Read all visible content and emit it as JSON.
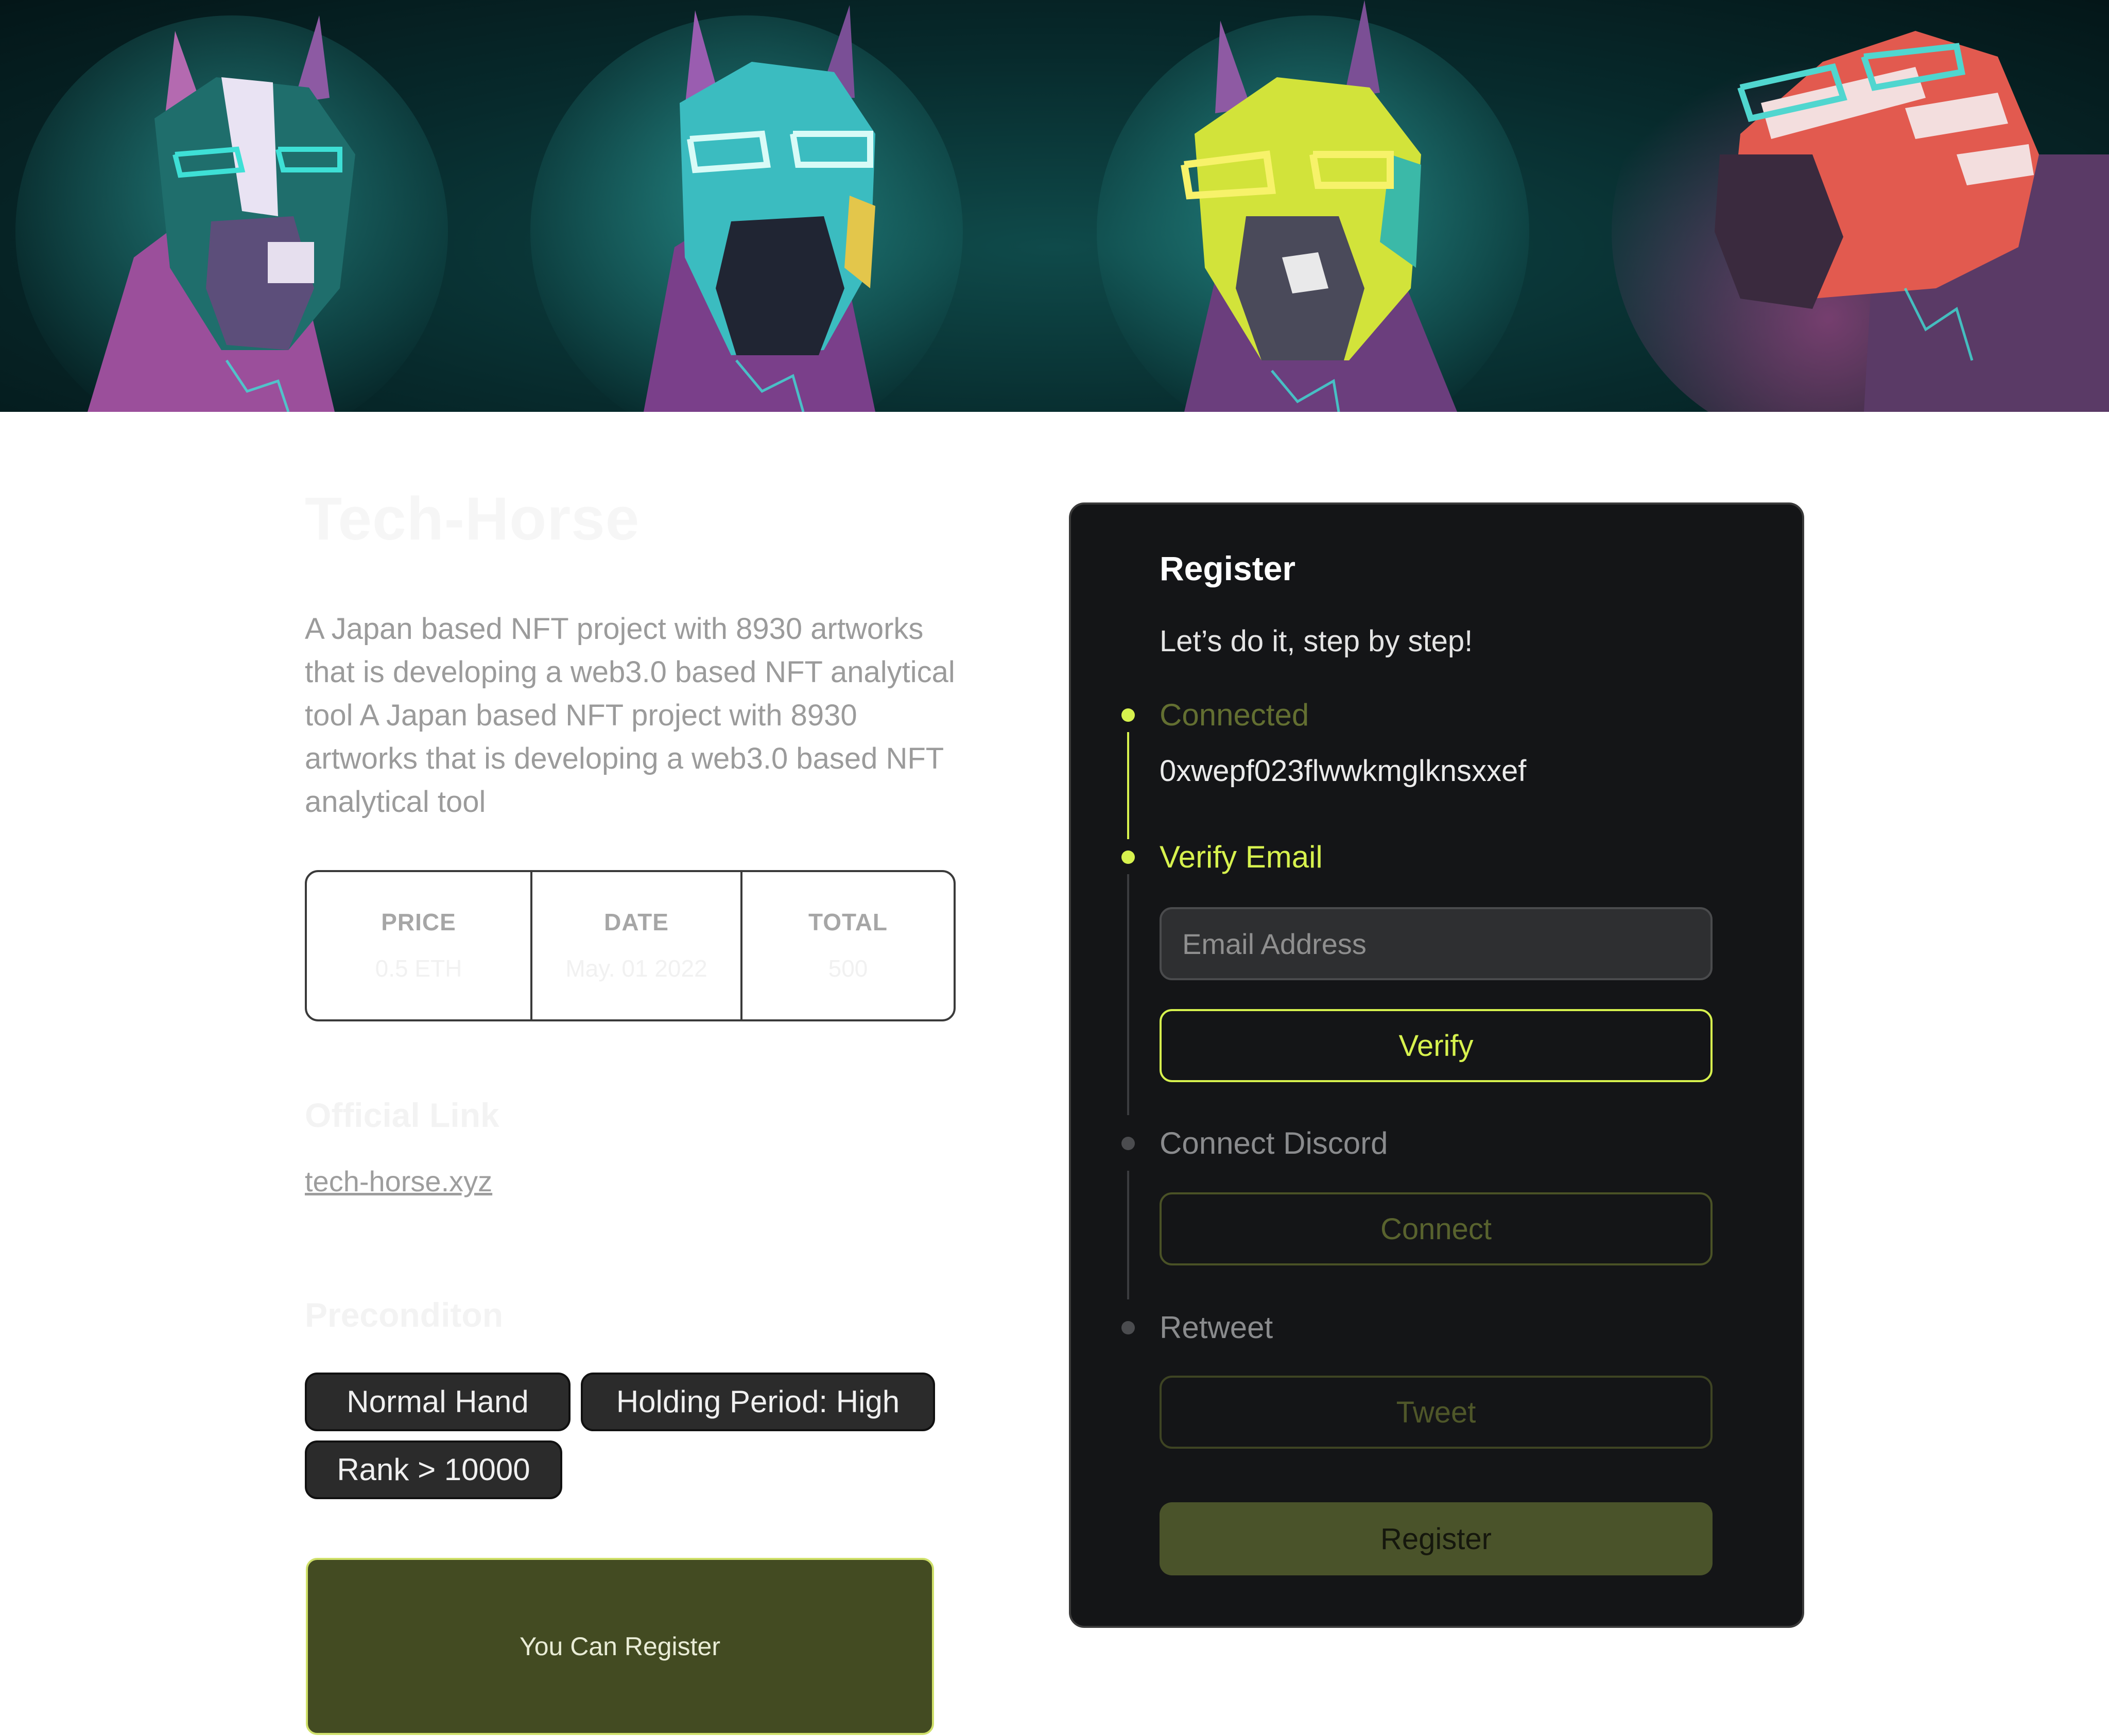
{
  "project": {
    "title": "Tech-Horse",
    "description": "A Japan based NFT project with 8930 artworks that is developing a web3.0 based NFT analytical tool A Japan based NFT project with 8930 artworks that is developing a web3.0 based NFT analytical tool"
  },
  "stats": [
    {
      "label": "PRICE",
      "value": "0.5 ETH"
    },
    {
      "label": "DATE",
      "value": "May. 01 2022"
    },
    {
      "label": "TOTAL",
      "value": "500"
    }
  ],
  "official_link": {
    "heading": "Official Link",
    "url_text": "tech-horse.xyz"
  },
  "precondition": {
    "heading": "Preconditon",
    "chips": [
      "Normal Hand",
      "Holding Period: High",
      "Rank > 10000"
    ]
  },
  "cta_label": "You Can Register",
  "register_panel": {
    "title": "Register",
    "subtitle": "Let’s do it, step by step!",
    "steps": {
      "connected": {
        "label": "Connected",
        "wallet": "0xwepf023flwwkmglknsxxef"
      },
      "verify_email": {
        "label": "Verify Email",
        "placeholder": "Email Address",
        "button": "Verify"
      },
      "discord": {
        "label": "Connect Discord",
        "button": "Connect"
      },
      "retweet": {
        "label": "Retweet",
        "button": "Tweet"
      }
    },
    "register_button": "Register"
  },
  "colors": {
    "accent": "#d7f24e",
    "accent_dim": "#636f31",
    "panel_bg": "#141517",
    "cta_bg": "#434b22"
  }
}
